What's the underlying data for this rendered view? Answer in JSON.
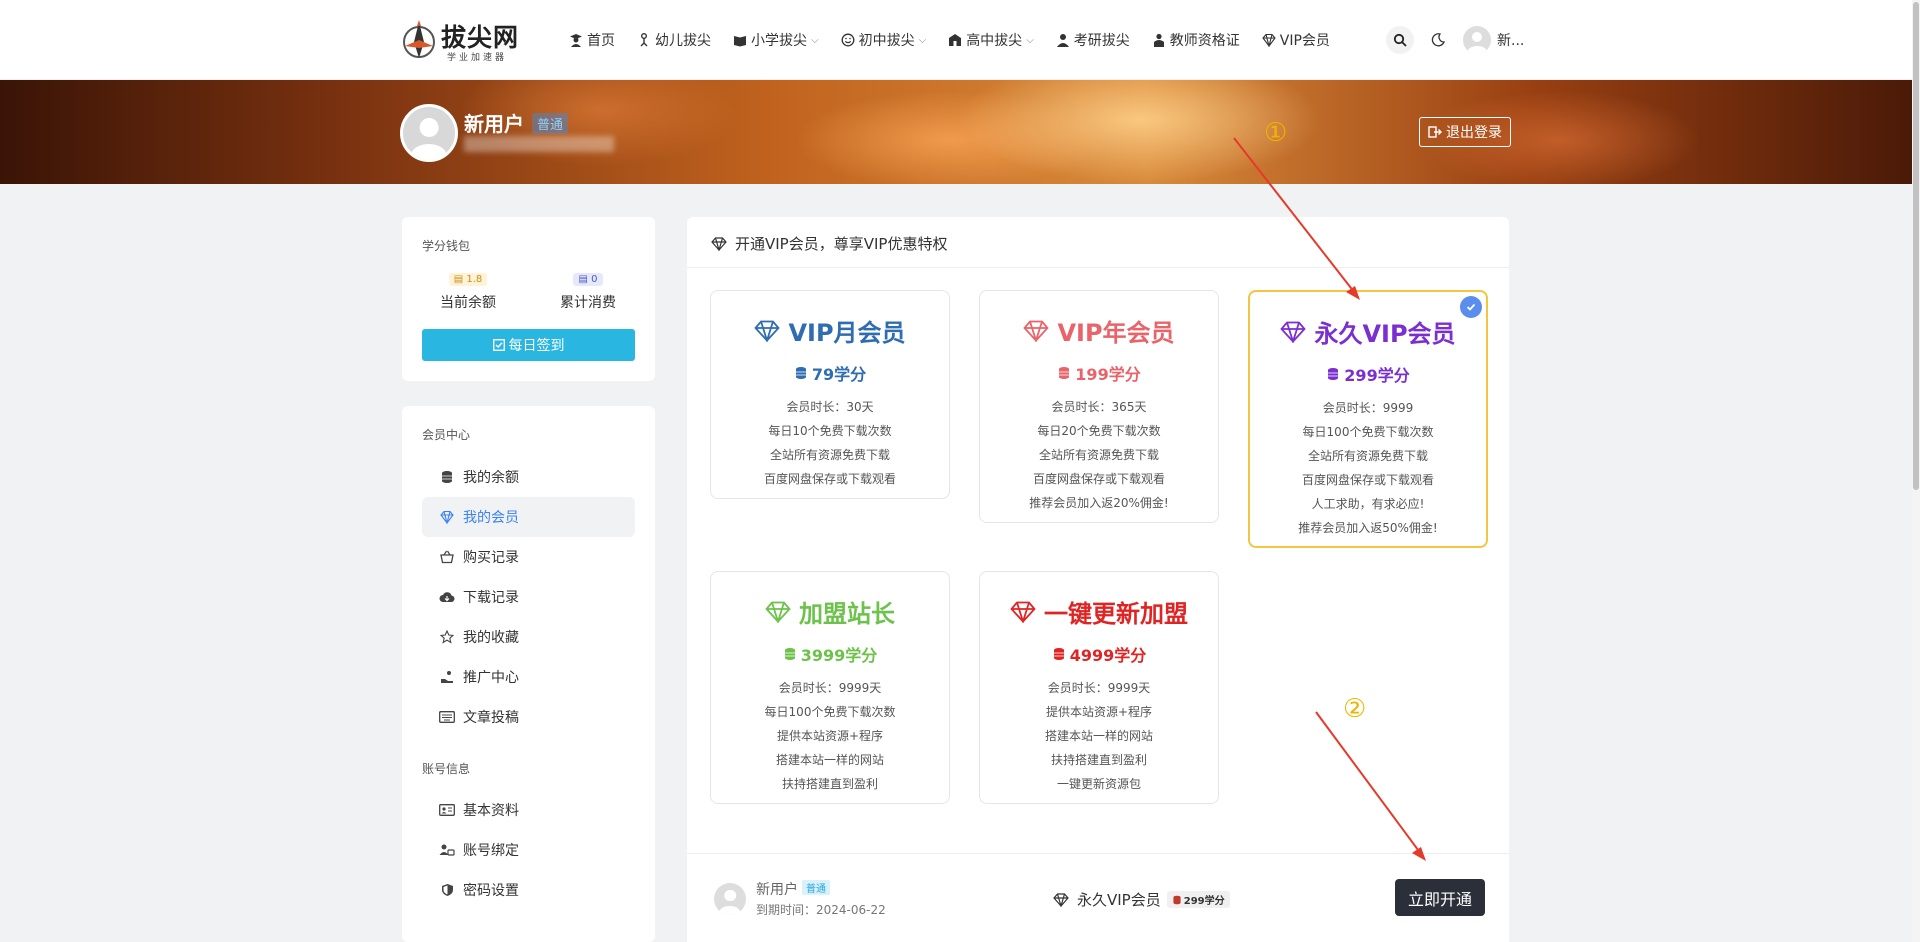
{
  "header": {
    "logo_name": "拔尖网",
    "logo_slogan": "学业加速器",
    "nav": [
      {
        "label": "首页",
        "icon": "user-graduate-icon"
      },
      {
        "label": "幼儿拔尖",
        "icon": "child-icon"
      },
      {
        "label": "小学拔尖",
        "icon": "book-open-icon"
      },
      {
        "label": "初中拔尖",
        "icon": "smile-icon"
      },
      {
        "label": "高中拔尖",
        "icon": "school-icon"
      },
      {
        "label": "考研拔尖",
        "icon": "user-tie-icon"
      },
      {
        "label": "教师资格证",
        "icon": "teacher-icon"
      },
      {
        "label": "VIP会员",
        "icon": "diamond-icon"
      }
    ],
    "user_name": "新..."
  },
  "banner": {
    "user_name": "新用户",
    "level_badge": "普通",
    "logout_label": "退出登录"
  },
  "wallet": {
    "title": "学分钱包",
    "balance_value": "1.8",
    "balance_label": "当前余额",
    "spent_value": "0",
    "spent_label": "累计消费",
    "checkin_label": "每日签到"
  },
  "member_menu": {
    "title": "会员中心",
    "items": [
      {
        "label": "我的余额",
        "icon": "coins-icon"
      },
      {
        "label": "我的会员",
        "icon": "diamond-icon"
      },
      {
        "label": "购买记录",
        "icon": "basket-icon"
      },
      {
        "label": "下载记录",
        "icon": "cloud-download-icon"
      },
      {
        "label": "我的收藏",
        "icon": "star-icon"
      },
      {
        "label": "推广中心",
        "icon": "hand-holding-icon"
      },
      {
        "label": "文章投稿",
        "icon": "keyboard-icon"
      }
    ],
    "account_title": "账号信息",
    "account_items": [
      {
        "label": "基本资料",
        "icon": "id-card-icon"
      },
      {
        "label": "账号绑定",
        "icon": "link-user-icon"
      },
      {
        "label": "密码设置",
        "icon": "shield-icon"
      }
    ]
  },
  "main": {
    "title": "开通VIP会员，尊享VIP优惠特权",
    "plans": [
      {
        "name": "VIP月会员",
        "price": "79学分",
        "color": "#2f6db0",
        "features": [
          "会员时长：30天",
          "每日10个免费下载次数",
          "全站所有资源免费下载",
          "百度网盘保存或下载观看"
        ]
      },
      {
        "name": "VIP年会员",
        "price": "199学分",
        "color": "#e8646a",
        "features": [
          "会员时长：365天",
          "每日20个免费下载次数",
          "全站所有资源免费下载",
          "百度网盘保存或下载观看",
          "推荐会员加入返20%佣金!"
        ]
      },
      {
        "name": "永久VIP会员",
        "price": "299学分",
        "color": "#7b2fd0",
        "features": [
          "会员时长：9999",
          "每日100个免费下载次数",
          "全站所有资源免费下载",
          "百度网盘保存或下载观看",
          "人工求助，有求必应!",
          "推荐会员加入返50%佣金!"
        ]
      },
      {
        "name": "加盟站长",
        "price": "3999学分",
        "color": "#6cc24a",
        "features": [
          "会员时长：9999天",
          "每日100个免费下载次数",
          "提供本站资源+程序",
          "搭建本站一样的网站",
          "扶持搭建直到盈利"
        ]
      },
      {
        "name": "一键更新加盟",
        "price": "4999学分",
        "color": "#e02424",
        "features": [
          "会员时长：9999天",
          "提供本站资源+程序",
          "搭建本站一样的网站",
          "扶持搭建直到盈利",
          "一键更新资源包"
        ]
      }
    ],
    "order": {
      "user_name": "新用户",
      "level_badge": "普通",
      "expire": "到期时间：2024-06-22",
      "selected_plan": "永久VIP会员",
      "selected_price": "299学分",
      "submit_label": "立即开通"
    }
  },
  "annotations": {
    "one": "①",
    "two": "②",
    "color": "#f0b400",
    "arrow_color": "#e53a2a"
  }
}
